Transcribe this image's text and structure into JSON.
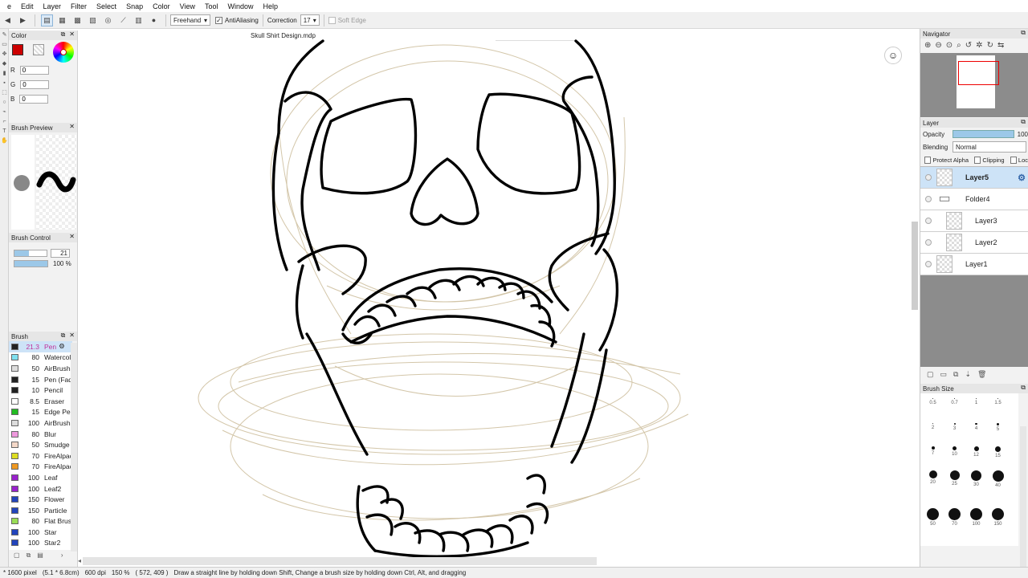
{
  "menu": [
    "e",
    "Edit",
    "Layer",
    "Filter",
    "Select",
    "Snap",
    "Color",
    "View",
    "Tool",
    "Window",
    "Help"
  ],
  "toolbar": {
    "mode_value": "Freehand",
    "antialiasing_label": "AntiAliasing",
    "correction_label": "Correction",
    "correction_value": "17",
    "soft_edge_label": "Soft Edge"
  },
  "document_tab": "Skull Shirt Design.mdp",
  "color_panel": {
    "title": "Color",
    "foreground": "#cc0000",
    "r_label": "R",
    "r_value": "0",
    "g_label": "G",
    "g_value": "0",
    "b_label": "B",
    "b_value": "0"
  },
  "brush_preview_panel": {
    "title": "Brush Preview"
  },
  "brush_control_panel": {
    "title": "Brush Control",
    "size_value": "21",
    "opacity_value": "100 %"
  },
  "brush_panel": {
    "title": "Brush",
    "items": [
      {
        "size": "21.3",
        "name": "Pen",
        "color": "#222222",
        "selected": true
      },
      {
        "size": "80",
        "name": "Watercolor",
        "color": "#7fe0f0"
      },
      {
        "size": "50",
        "name": "AirBrush",
        "color": "#dddddd"
      },
      {
        "size": "15",
        "name": "Pen (Fade)",
        "color": "#222222"
      },
      {
        "size": "10",
        "name": "Pencil",
        "color": "#222222"
      },
      {
        "size": "8.5",
        "name": "Eraser",
        "color": "#ffffff"
      },
      {
        "size": "15",
        "name": "Edge Pen",
        "color": "#22bb22"
      },
      {
        "size": "100",
        "name": "AirBrush",
        "color": "#dddddd"
      },
      {
        "size": "80",
        "name": "Blur",
        "color": "#ee99dd"
      },
      {
        "size": "50",
        "name": "Smudge",
        "color": "#f4d8c8"
      },
      {
        "size": "70",
        "name": "FireAlpaca",
        "color": "#dddd22"
      },
      {
        "size": "70",
        "name": "FireAlpaca",
        "color": "#ee9922"
      },
      {
        "size": "100",
        "name": "Leaf",
        "color": "#9922cc"
      },
      {
        "size": "100",
        "name": "Leaf2",
        "color": "#9922cc"
      },
      {
        "size": "150",
        "name": "Flower",
        "color": "#2244bb"
      },
      {
        "size": "150",
        "name": "Particle",
        "color": "#2244bb"
      },
      {
        "size": "80",
        "name": "Flat Brush",
        "color": "#99dd55"
      },
      {
        "size": "100",
        "name": "Star",
        "color": "#2244bb"
      },
      {
        "size": "100",
        "name": "Star2",
        "color": "#2244bb"
      }
    ]
  },
  "navigator": {
    "title": "Navigator"
  },
  "layer_panel": {
    "title": "Layer",
    "opacity_label": "Opacity",
    "opacity_value": "100",
    "blending_label": "Blending",
    "blending_value": "Normal",
    "protect_alpha_label": "Protect Alpha",
    "clipping_label": "Clipping",
    "lock_label": "Loc",
    "layers": [
      {
        "name": "Layer5",
        "selected": true,
        "folder": false,
        "indent": false
      },
      {
        "name": "Folder4",
        "selected": false,
        "folder": true,
        "indent": false
      },
      {
        "name": "Layer3",
        "selected": false,
        "folder": false,
        "indent": true
      },
      {
        "name": "Layer2",
        "selected": false,
        "folder": false,
        "indent": true
      },
      {
        "name": "Layer1",
        "selected": false,
        "folder": false,
        "indent": false
      }
    ]
  },
  "brush_size_panel": {
    "title": "Brush Size",
    "sizes": [
      "0.5",
      "0.7",
      "1",
      "1.5",
      "2",
      "3",
      "4",
      "5",
      "7",
      "10",
      "12",
      "15",
      "20",
      "25",
      "30",
      "40",
      "50",
      "70",
      "100",
      "150"
    ]
  },
  "status": {
    "image_size": "* 1600 pixel",
    "physical_size": "(5.1 * 6.8cm)",
    "dpi": "600 dpi",
    "zoom": "150 %",
    "cursor": "( 572, 409 )",
    "hint": "Draw a straight line by holding down Shift, Change a brush size by holding down Ctrl, Alt, and dragging"
  }
}
